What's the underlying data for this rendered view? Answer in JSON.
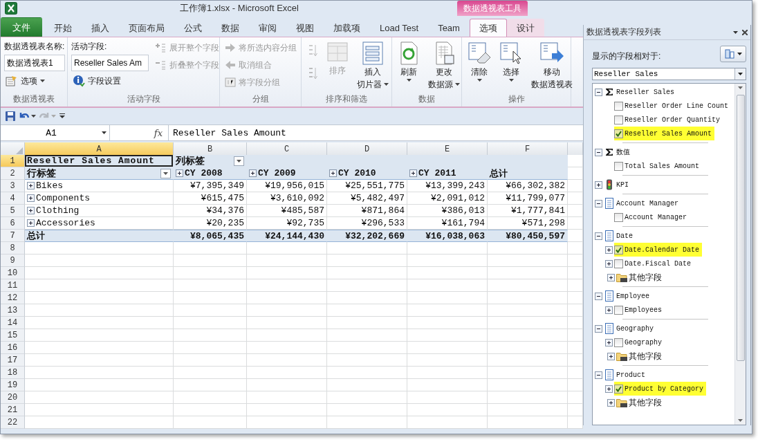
{
  "window": {
    "title": "工作簿1.xlsx  -  Microsoft Excel",
    "context_group": "数据透视表工具"
  },
  "tabs": [
    {
      "label": "文件",
      "kind": "file",
      "selected": false
    },
    {
      "label": "开始",
      "kind": "normal",
      "selected": false
    },
    {
      "label": "插入",
      "kind": "normal",
      "selected": false
    },
    {
      "label": "页面布局",
      "kind": "normal",
      "selected": false
    },
    {
      "label": "公式",
      "kind": "normal",
      "selected": false
    },
    {
      "label": "数据",
      "kind": "normal",
      "selected": false
    },
    {
      "label": "审阅",
      "kind": "normal",
      "selected": false
    },
    {
      "label": "视图",
      "kind": "normal",
      "selected": false
    },
    {
      "label": "加载项",
      "kind": "normal",
      "selected": false
    },
    {
      "label": "Load Test",
      "kind": "normal",
      "selected": false
    },
    {
      "label": "Team",
      "kind": "normal",
      "selected": false
    },
    {
      "label": "选项",
      "kind": "contextual",
      "selected": true
    },
    {
      "label": "设计",
      "kind": "contextual",
      "selected": false
    }
  ],
  "ribbon": [
    {
      "label": "数据透视表",
      "columns": [
        [
          {
            "kind": "caption",
            "text": "数据透视表名称:"
          },
          {
            "kind": "field",
            "value": "数据透视表1"
          },
          {
            "kind": "small",
            "label": "选项",
            "disabled": false,
            "dropdown": true
          }
        ]
      ]
    },
    {
      "label": "活动字段",
      "columns": [
        [
          {
            "kind": "caption",
            "text": "活动字段:"
          },
          {
            "kind": "field",
            "value": "Reseller Sales Am"
          },
          {
            "kind": "small",
            "label": "字段设置",
            "disabled": false,
            "dropdown": false
          }
        ],
        [
          {
            "kind": "small",
            "label": "展开整个字段",
            "disabled": true,
            "dropdown": false
          },
          {
            "kind": "small",
            "label": "折叠整个字段",
            "disabled": true,
            "dropdown": false
          }
        ]
      ]
    },
    {
      "label": "分组",
      "columns": [
        [
          {
            "kind": "small",
            "label": "将所选内容分组",
            "disabled": true,
            "dropdown": false
          },
          {
            "kind": "small",
            "label": "取消组合",
            "disabled": true,
            "dropdown": false
          },
          {
            "kind": "small",
            "label": "将字段分组",
            "disabled": true,
            "dropdown": false
          }
        ]
      ]
    },
    {
      "label": "排序和筛选",
      "columns": [
        [
          {
            "kind": "icon",
            "disabled": true
          },
          {
            "kind": "icon",
            "disabled": true
          }
        ],
        [
          {
            "kind": "large",
            "lines": [
              "排序"
            ],
            "disabled": true,
            "dropdown": false
          }
        ],
        [
          {
            "kind": "large",
            "lines": [
              "插入",
              "切片器"
            ],
            "disabled": false,
            "dropdown": true
          }
        ]
      ]
    },
    {
      "label": "数据",
      "columns": [
        [
          {
            "kind": "large",
            "lines": [
              "刷新"
            ],
            "disabled": false,
            "dropdown": true
          }
        ],
        [
          {
            "kind": "large",
            "lines": [
              "更改",
              "数据源"
            ],
            "disabled": false,
            "dropdown": true
          }
        ]
      ]
    },
    {
      "label": "操作",
      "columns": [
        [
          {
            "kind": "large",
            "lines": [
              "清除"
            ],
            "disabled": false,
            "dropdown": true
          }
        ],
        [
          {
            "kind": "large",
            "lines": [
              "选择"
            ],
            "disabled": false,
            "dropdown": true
          }
        ],
        [
          {
            "kind": "large",
            "lines": [
              "移动",
              "数据透视表"
            ],
            "disabled": false,
            "dropdown": false
          }
        ]
      ]
    }
  ],
  "formula_bar": {
    "name_box": "A1",
    "function_label": "fx",
    "formula": "Reseller Sales Amount"
  },
  "grid": {
    "columns": [
      {
        "label": "A",
        "selected": true
      },
      {
        "label": "B",
        "selected": false
      },
      {
        "label": "C",
        "selected": false
      },
      {
        "label": "D",
        "selected": false
      },
      {
        "label": "E",
        "selected": false
      },
      {
        "label": "F",
        "selected": false
      }
    ],
    "rows": [
      {
        "number": "1",
        "selected": true,
        "kind": "header",
        "cells": [
          {
            "text": "Reseller Sales Amount",
            "kind": "plain",
            "selected": true
          },
          {
            "text": "列标签",
            "kind": "filter",
            "selected": false
          }
        ]
      },
      {
        "number": "2",
        "selected": false,
        "kind": "header",
        "cells": [
          {
            "text": "行标签",
            "kind": "filter",
            "selected": false
          },
          {
            "text": "CY 2008",
            "kind": "expand",
            "selected": false
          },
          {
            "text": "CY 2009",
            "kind": "expand",
            "selected": false
          },
          {
            "text": "CY 2010",
            "kind": "expand",
            "selected": false
          },
          {
            "text": "CY 2011",
            "kind": "expand",
            "selected": false
          },
          {
            "text": "总计",
            "kind": "plain",
            "selected": false
          }
        ]
      },
      {
        "number": "3",
        "selected": false,
        "kind": "data",
        "cells": [
          {
            "text": "Bikes",
            "kind": "expand",
            "selected": false
          },
          {
            "text": "¥7,395,349",
            "kind": "plain",
            "selected": false
          },
          {
            "text": "¥19,956,015",
            "kind": "plain",
            "selected": false
          },
          {
            "text": "¥25,551,775",
            "kind": "plain",
            "selected": false
          },
          {
            "text": "¥13,399,243",
            "kind": "plain",
            "selected": false
          },
          {
            "text": "¥66,302,382",
            "kind": "plain",
            "selected": false
          }
        ]
      },
      {
        "number": "4",
        "selected": false,
        "kind": "data",
        "cells": [
          {
            "text": "Components",
            "kind": "expand",
            "selected": false
          },
          {
            "text": "¥615,475",
            "kind": "plain",
            "selected": false
          },
          {
            "text": "¥3,610,092",
            "kind": "plain",
            "selected": false
          },
          {
            "text": "¥5,482,497",
            "kind": "plain",
            "selected": false
          },
          {
            "text": "¥2,091,012",
            "kind": "plain",
            "selected": false
          },
          {
            "text": "¥11,799,077",
            "kind": "plain",
            "selected": false
          }
        ]
      },
      {
        "number": "5",
        "selected": false,
        "kind": "data",
        "cells": [
          {
            "text": "Clothing",
            "kind": "expand",
            "selected": false
          },
          {
            "text": "¥34,376",
            "kind": "plain",
            "selected": false
          },
          {
            "text": "¥485,587",
            "kind": "plain",
            "selected": false
          },
          {
            "text": "¥871,864",
            "kind": "plain",
            "selected": false
          },
          {
            "text": "¥386,013",
            "kind": "plain",
            "selected": false
          },
          {
            "text": "¥1,777,841",
            "kind": "plain",
            "selected": false
          }
        ]
      },
      {
        "number": "6",
        "selected": false,
        "kind": "data",
        "cells": [
          {
            "text": "Accessories",
            "kind": "expand",
            "selected": false
          },
          {
            "text": "¥20,235",
            "kind": "plain",
            "selected": false
          },
          {
            "text": "¥92,735",
            "kind": "plain",
            "selected": false
          },
          {
            "text": "¥296,533",
            "kind": "plain",
            "selected": false
          },
          {
            "text": "¥161,794",
            "kind": "plain",
            "selected": false
          },
          {
            "text": "¥571,298",
            "kind": "plain",
            "selected": false
          }
        ]
      },
      {
        "number": "7",
        "selected": false,
        "kind": "total",
        "cells": [
          {
            "text": "总计",
            "kind": "plain",
            "selected": false
          },
          {
            "text": "¥8,065,435",
            "kind": "plain",
            "selected": false
          },
          {
            "text": "¥24,144,430",
            "kind": "plain",
            "selected": false
          },
          {
            "text": "¥32,202,669",
            "kind": "plain",
            "selected": false
          },
          {
            "text": "¥16,038,063",
            "kind": "plain",
            "selected": false
          },
          {
            "text": "¥80,450,597",
            "kind": "plain",
            "selected": false
          }
        ]
      },
      {
        "number": "8",
        "selected": false,
        "kind": "empty"
      },
      {
        "number": "9",
        "selected": false,
        "kind": "empty"
      },
      {
        "number": "10",
        "selected": false,
        "kind": "empty"
      },
      {
        "number": "11",
        "selected": false,
        "kind": "empty"
      },
      {
        "number": "12",
        "selected": false,
        "kind": "empty"
      },
      {
        "number": "13",
        "selected": false,
        "kind": "empty"
      },
      {
        "number": "14",
        "selected": false,
        "kind": "empty"
      },
      {
        "number": "15",
        "selected": false,
        "kind": "empty"
      },
      {
        "number": "16",
        "selected": false,
        "kind": "empty"
      },
      {
        "number": "17",
        "selected": false,
        "kind": "empty"
      },
      {
        "number": "18",
        "selected": false,
        "kind": "empty"
      },
      {
        "number": "19",
        "selected": false,
        "kind": "empty"
      },
      {
        "number": "20",
        "selected": false,
        "kind": "empty"
      },
      {
        "number": "21",
        "selected": false,
        "kind": "empty"
      },
      {
        "number": "22",
        "selected": false,
        "kind": "empty"
      }
    ]
  },
  "field_list": {
    "title": "数据透视表字段列表",
    "relative_label": "显示的字段相对于:",
    "source": "Reseller Sales",
    "groups": [
      {
        "label": "Reseller Sales",
        "kind": "measure",
        "expanded": true,
        "children": [
          {
            "label": "Reseller Order Line Count",
            "kind": "field",
            "checked": false,
            "highlighted": false
          },
          {
            "label": "Reseller Order Quantity",
            "kind": "field",
            "checked": false,
            "highlighted": false
          },
          {
            "label": "Reseller Sales Amount",
            "kind": "field",
            "checked": true,
            "highlighted": true
          }
        ]
      },
      {
        "label": "数值",
        "kind": "measure",
        "expanded": true,
        "children": [
          {
            "label": "Total Sales Amount",
            "kind": "field",
            "checked": false,
            "highlighted": false
          }
        ]
      },
      {
        "label": "KPI",
        "kind": "kpi",
        "expanded": false
      },
      {
        "label": "Account Manager",
        "kind": "dimension",
        "expanded": true,
        "children": [
          {
            "label": "Account Manager",
            "kind": "field",
            "checked": false,
            "highlighted": false
          }
        ]
      },
      {
        "label": "Date",
        "kind": "dimension",
        "expanded": true,
        "children": [
          {
            "label": "Date.Calendar Date",
            "kind": "hierarchy",
            "checked": true,
            "highlighted": true
          },
          {
            "label": "Date.Fiscal Date",
            "kind": "hierarchy",
            "checked": false,
            "highlighted": false
          },
          {
            "label": "其他字段",
            "kind": "folder"
          }
        ]
      },
      {
        "label": "Employee",
        "kind": "dimension",
        "expanded": true,
        "children": [
          {
            "label": "Employees",
            "kind": "hierarchy",
            "checked": false,
            "highlighted": false
          }
        ]
      },
      {
        "label": "Geography",
        "kind": "dimension",
        "expanded": true,
        "children": [
          {
            "label": "Geography",
            "kind": "hierarchy",
            "checked": false,
            "highlighted": false
          },
          {
            "label": "其他字段",
            "kind": "folder"
          }
        ]
      },
      {
        "label": "Product",
        "kind": "dimension",
        "expanded": true,
        "children": [
          {
            "label": "Product by Category",
            "kind": "hierarchy",
            "checked": true,
            "highlighted": true
          },
          {
            "label": "其他字段",
            "kind": "folder"
          }
        ]
      }
    ]
  }
}
